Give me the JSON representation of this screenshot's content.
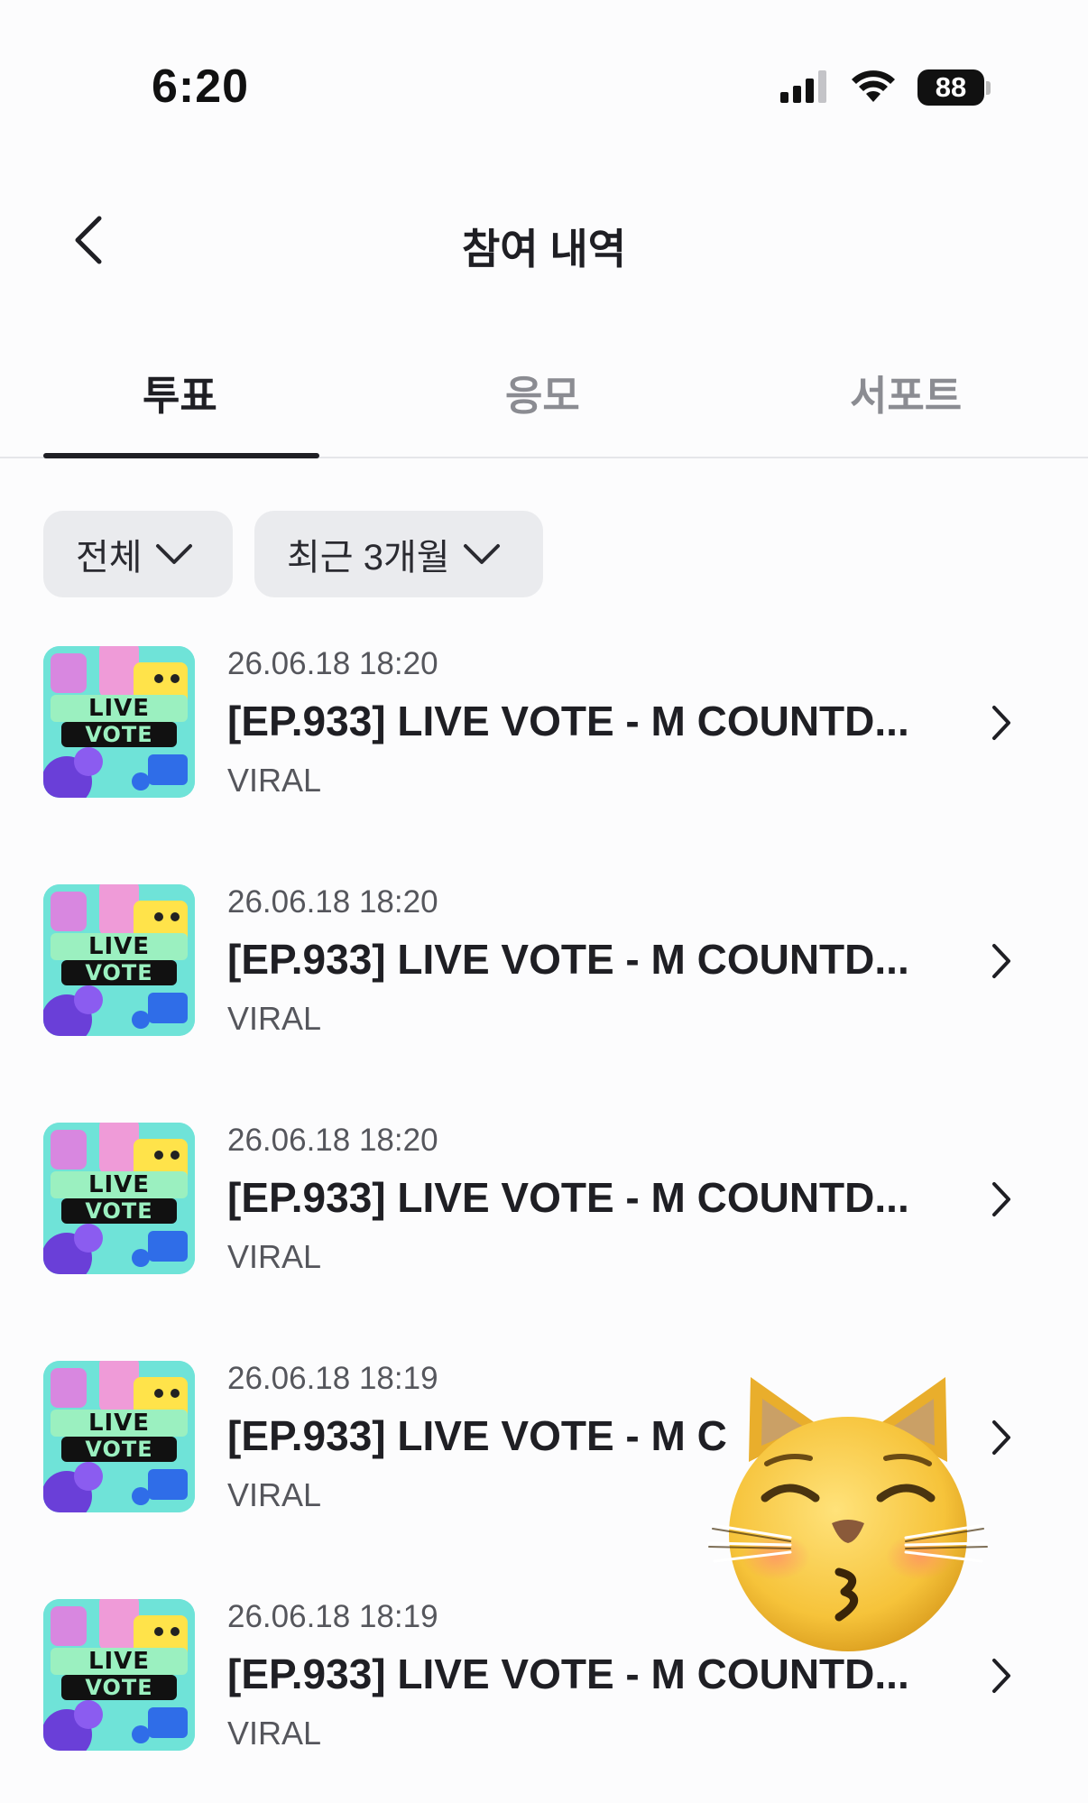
{
  "status_bar": {
    "time": "6:20",
    "battery_level": "88"
  },
  "header": {
    "title": "참여 내역"
  },
  "tabs": [
    {
      "label": "투표",
      "active": true
    },
    {
      "label": "응모",
      "active": false
    },
    {
      "label": "서포트",
      "active": false
    }
  ],
  "filters": {
    "type_label": "전체",
    "period_label": "최근 3개월"
  },
  "thumbnail_text": {
    "line1": "LIVE",
    "line2": "VOTE"
  },
  "items": [
    {
      "date": "26.06.18 18:20",
      "title": "[EP.933] LIVE VOTE - M COUNTD...",
      "category": "VIRAL"
    },
    {
      "date": "26.06.18 18:20",
      "title": "[EP.933] LIVE VOTE - M COUNTD...",
      "category": "VIRAL"
    },
    {
      "date": "26.06.18 18:20",
      "title": "[EP.933] LIVE VOTE - M COUNTD...",
      "category": "VIRAL"
    },
    {
      "date": "26.06.18 18:19",
      "title": "[EP.933] LIVE VOTE - M C",
      "category": "VIRAL"
    },
    {
      "date": "26.06.18 18:19",
      "title": "[EP.933] LIVE VOTE - M COUNTD...",
      "category": "VIRAL"
    }
  ],
  "colors": {
    "accent": "#1f1f24",
    "chip_bg": "#eaebee",
    "muted_text": "#55565c",
    "inactive_tab": "#8b8c92"
  }
}
